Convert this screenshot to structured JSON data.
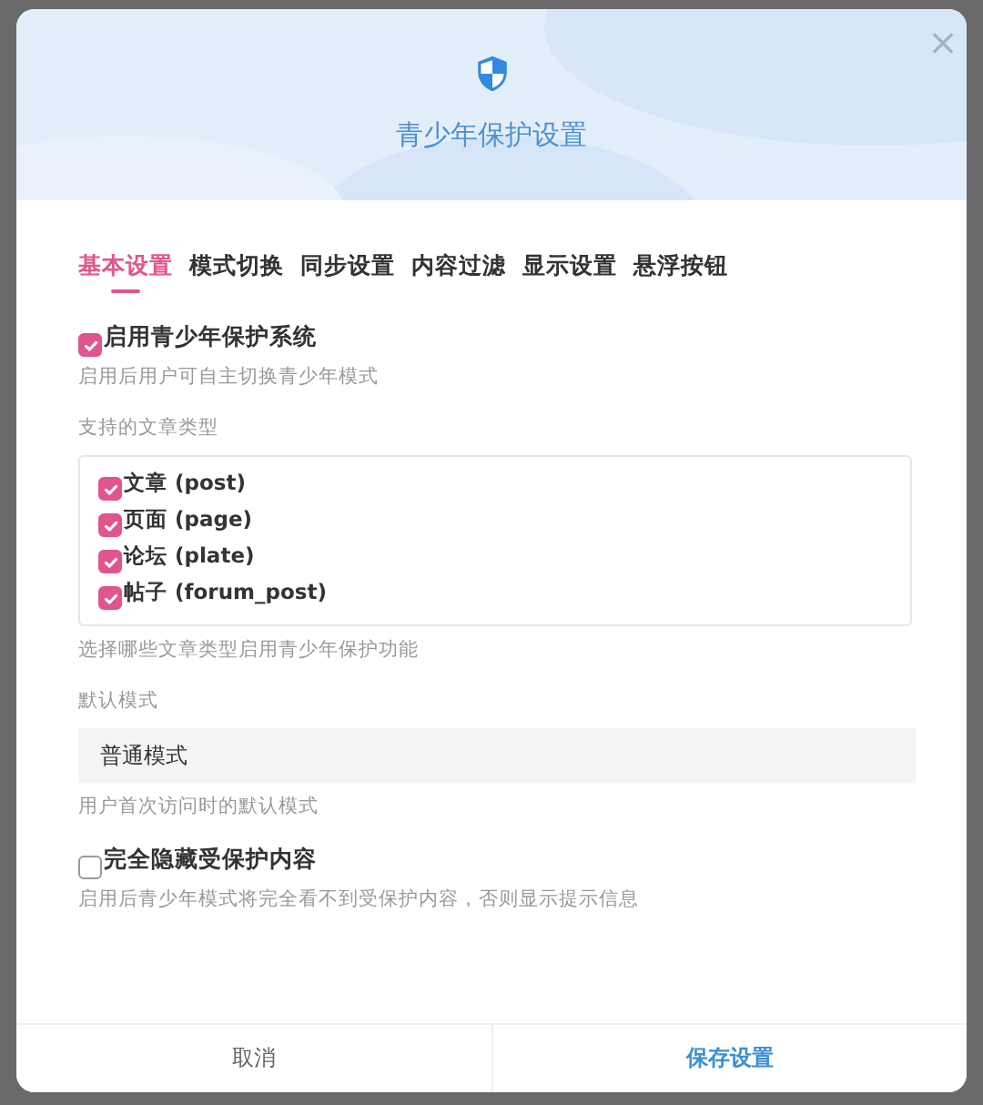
{
  "dialog": {
    "title": "青少年保护设置",
    "close": "×"
  },
  "tabs": [
    {
      "label": "基本设置",
      "selected": true
    },
    {
      "label": "模式切换",
      "selected": false
    },
    {
      "label": "同步设置",
      "selected": false
    },
    {
      "label": "内容过滤",
      "selected": false
    },
    {
      "label": "显示设置",
      "selected": false
    },
    {
      "label": "悬浮按钮",
      "selected": false
    }
  ],
  "enable": {
    "label": "启用青少年保护系统",
    "checked": true,
    "help": "启用后用户可自主切换青少年模式"
  },
  "post_types": {
    "label": "支持的文章类型",
    "options": [
      {
        "label": "文章 (post)",
        "checked": true
      },
      {
        "label": "页面 (page)",
        "checked": true
      },
      {
        "label": "论坛 (plate)",
        "checked": true
      },
      {
        "label": "帖子 (forum_post)",
        "checked": true
      }
    ],
    "help": "选择哪些文章类型启用青少年保护功能"
  },
  "default_mode": {
    "label": "默认模式",
    "value": "普通模式",
    "help": "用户首次访问时的默认模式"
  },
  "hide": {
    "label": "完全隐藏受保护内容",
    "checked": false,
    "help": "启用后青少年模式将完全看不到受保护内容，否则显示提示信息"
  },
  "buttons": [
    {
      "label": "取消",
      "kind": "secondary"
    },
    {
      "label": "保存设置",
      "kind": "primary"
    }
  ]
}
